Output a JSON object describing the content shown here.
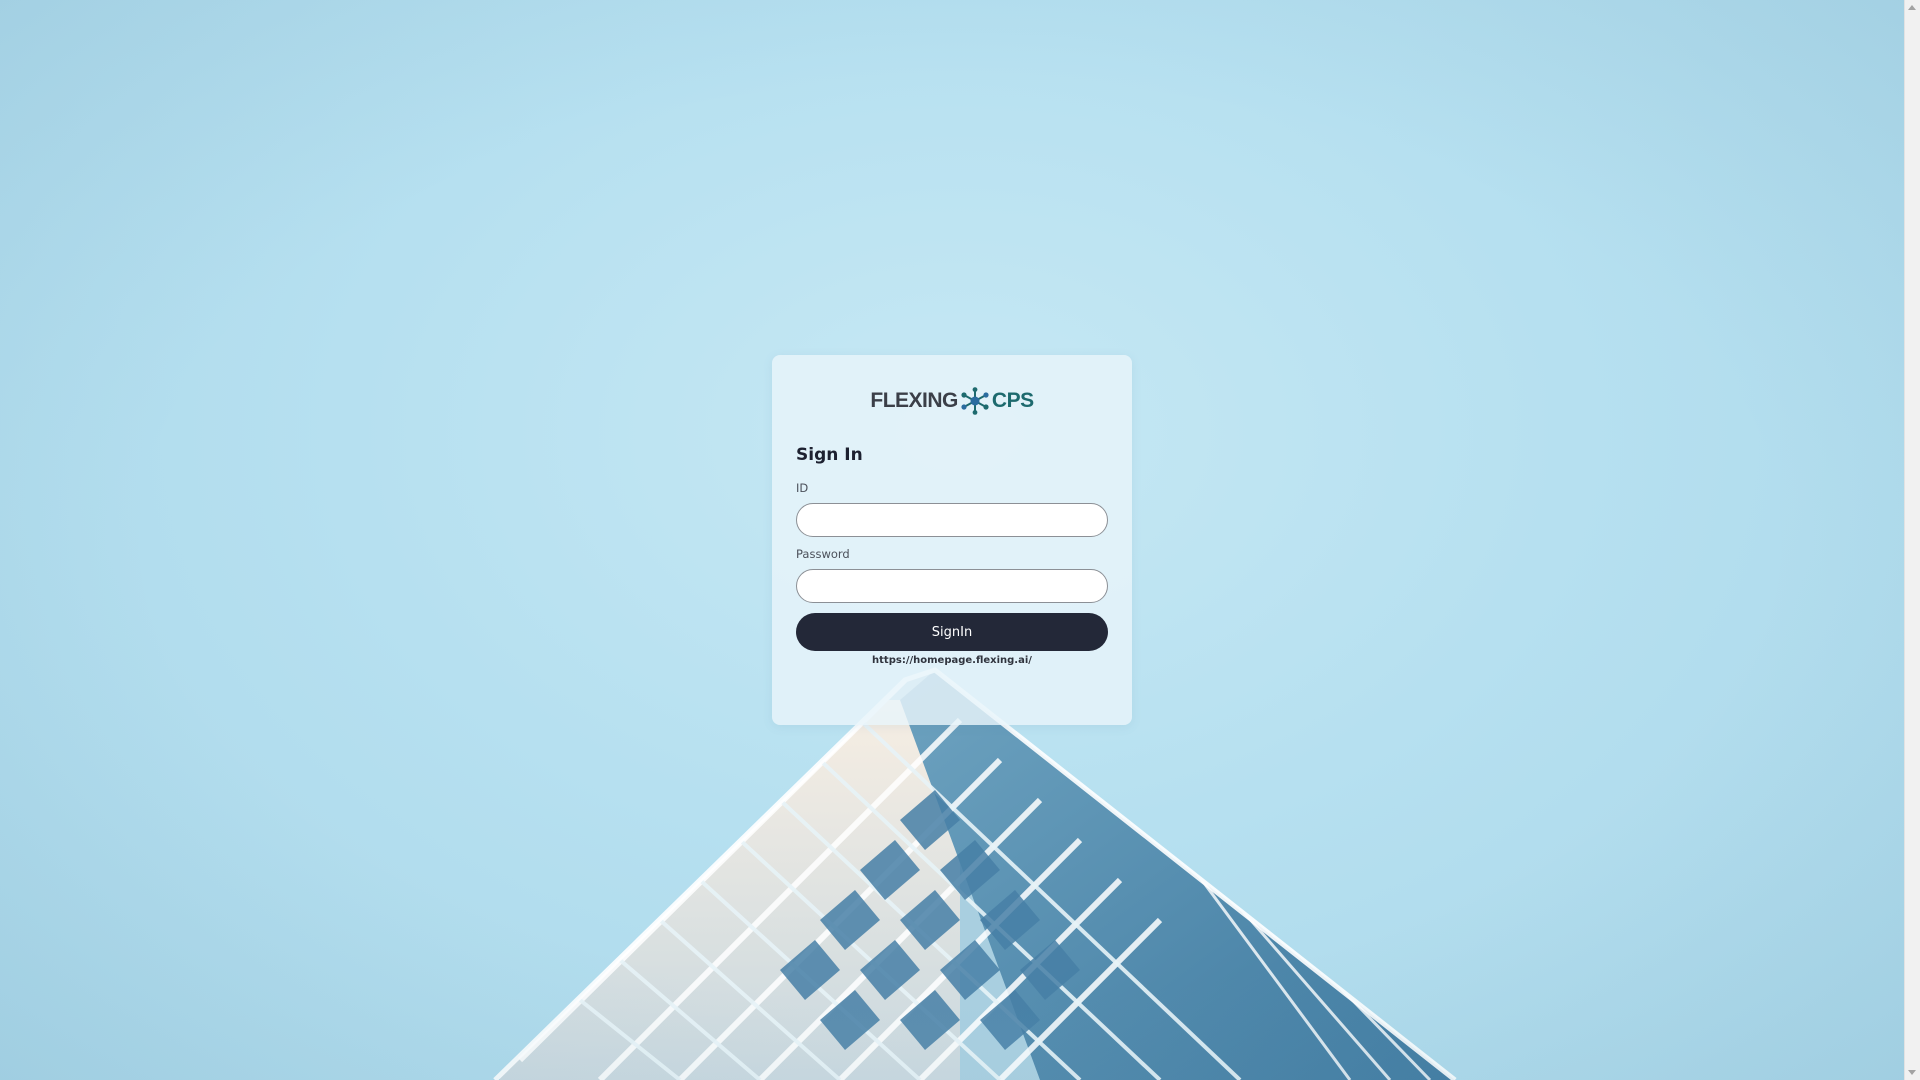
{
  "logo": {
    "left_word": "FLEXING",
    "right_word": "CPS",
    "left_color": "#3b3f48",
    "right_color": "#1d6a6e",
    "mark_icon": "molecule-network-icon"
  },
  "form": {
    "title": "Sign In",
    "id_label": "ID",
    "id_value": "",
    "password_label": "Password",
    "password_value": "",
    "submit_label": "SignIn",
    "homepage_link": "https://homepage.flexing.ai/"
  },
  "colors": {
    "button_bg": "#232838",
    "sky": "#b6e0f0"
  }
}
